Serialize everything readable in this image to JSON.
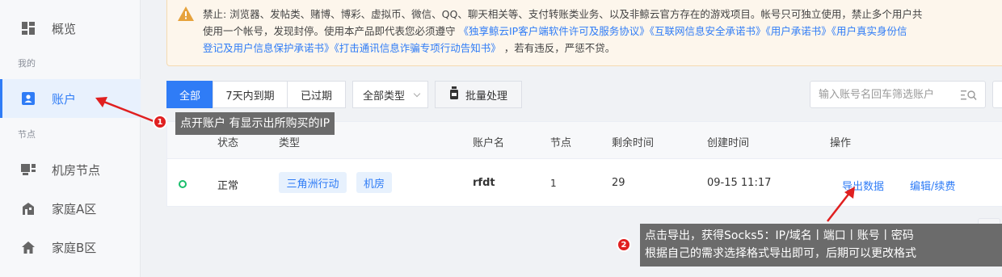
{
  "sidebar": {
    "overview": "概览",
    "group_mine": "我的",
    "account": "账户",
    "group_nodes": "节点",
    "datacenter": "机房节点",
    "home_a": "家庭A区",
    "home_b": "家庭B区"
  },
  "notice": {
    "line1": "禁止: 浏览器、发帖类、赌博、博彩、虚拟币、微信、QQ、聊天相关等、支付转账类业务、以及非鲸云官方存在的游戏项目。帐号只可独立使用，禁止多个用户共",
    "line2_prefix": "使用一个帐号，发现封停。使用本产品即代表您必须遵守",
    "links_line2": "《独享鲸云IP客户端软件许可及服务协议》《互联网信息安全承诺书》《用户承诺书》《用户真实身份信",
    "links_line3": "登记及用户信息保护承诺书》《打击通讯信息诈骗专项行动告知书》",
    "line3_suffix": "，若有违反，严惩不贷。"
  },
  "toolbar": {
    "tabs": [
      "全部",
      "7天内到期",
      "已过期"
    ],
    "type_select": "全部类型",
    "batch_label": "批量处理",
    "search_placeholder": "输入账号名回车筛选账户"
  },
  "table": {
    "headers": [
      "状态",
      "类型",
      "账户名",
      "节点",
      "剩余时间",
      "创建时间",
      "操作"
    ],
    "row": {
      "status": "正常",
      "tags": [
        "三角洲行动",
        "机房"
      ],
      "account": "rfdt",
      "nodes": "1",
      "remaining": "29",
      "created": "09-15 11:17",
      "action_export": "导出数据",
      "action_edit": "编辑/续费"
    }
  },
  "annotations": {
    "one": {
      "badge": "1",
      "text": "点开账户 有显示出所购买的IP"
    },
    "two": {
      "badge": "2",
      "line1": "点击导出，获得Socks5：IP/域名丨端口丨账号丨密码",
      "line2": "根据自己的需求选择格式导出即可，后期可以更改格式"
    }
  },
  "colors": {
    "accent": "#2f7cf6",
    "status_ok": "#19be6b",
    "annotation_bg": "#6b6b6b",
    "annotation_arrow": "#e02020"
  }
}
